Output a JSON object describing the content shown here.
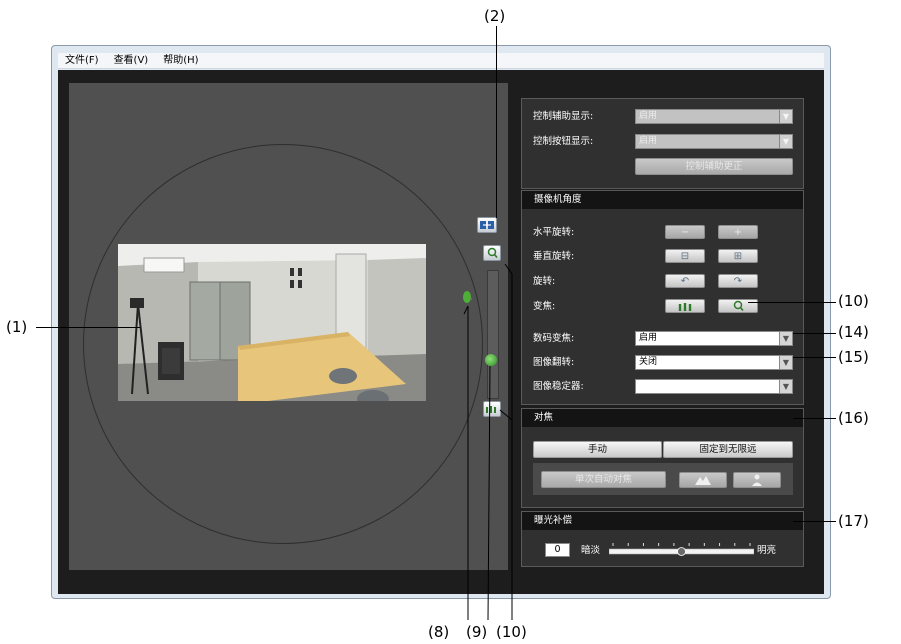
{
  "menubar": {
    "items": [
      "文件(F)",
      "查看(V)",
      "帮助(H)"
    ]
  },
  "control_assist": {
    "display_label": "控制辅助显示:",
    "display_value": "启用",
    "button_display_label": "控制按钮显示:",
    "button_display_value": "启用",
    "correct_button": "控制辅助更正"
  },
  "camera_angle": {
    "header": "摄像机角度",
    "pan_label": "水平旋转:",
    "tilt_label": "垂直旋转:",
    "rotate_label": "旋转:",
    "zoom_label": "变焦:",
    "digital_zoom_label": "数码变焦:",
    "digital_zoom_value": "启用",
    "image_flip_label": "图像翻转:",
    "image_flip_value": "关闭",
    "stabilizer_label": "图像稳定器:",
    "stabilizer_value": ""
  },
  "focus": {
    "header": "对焦",
    "manual_button": "手动",
    "infinity_button": "固定到无限远",
    "one_shot_af_button": "单次自动对焦"
  },
  "exposure": {
    "header": "曝光补偿",
    "value": "0",
    "dark_label": "暗淡",
    "bright_label": "明亮",
    "level": 0.5
  },
  "zoom_slider": {
    "level": 0.28
  },
  "callouts": [
    "(1)",
    "(2)",
    "(8)",
    "(9)",
    "(10)",
    "(10)",
    "(14)",
    "(15)",
    "(16)",
    "(17)"
  ],
  "colors": {
    "content_bg": "#1d1d1d",
    "viewer_bg": "#505050",
    "panel_bg": "#303030"
  }
}
